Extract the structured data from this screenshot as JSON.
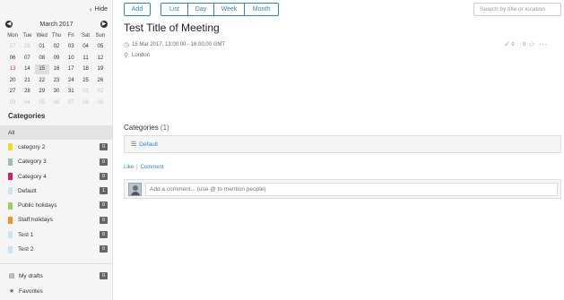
{
  "sidebar": {
    "hide_label": "Hide",
    "calendar": {
      "title": "March 2017",
      "weekdays": [
        "Mon",
        "Tue",
        "Wed",
        "Thu",
        "Fri",
        "Sat",
        "Sun"
      ],
      "weeks": [
        [
          {
            "d": "27",
            "s": "muted"
          },
          {
            "d": "28",
            "s": "muted"
          },
          {
            "d": "01",
            "s": ""
          },
          {
            "d": "02",
            "s": ""
          },
          {
            "d": "03",
            "s": ""
          },
          {
            "d": "04",
            "s": ""
          },
          {
            "d": "05",
            "s": ""
          }
        ],
        [
          {
            "d": "06",
            "s": ""
          },
          {
            "d": "07",
            "s": ""
          },
          {
            "d": "08",
            "s": ""
          },
          {
            "d": "09",
            "s": ""
          },
          {
            "d": "10",
            "s": ""
          },
          {
            "d": "11",
            "s": ""
          },
          {
            "d": "12",
            "s": ""
          }
        ],
        [
          {
            "d": "13",
            "s": "red"
          },
          {
            "d": "14",
            "s": ""
          },
          {
            "d": "15",
            "s": "today"
          },
          {
            "d": "16",
            "s": ""
          },
          {
            "d": "17",
            "s": ""
          },
          {
            "d": "18",
            "s": ""
          },
          {
            "d": "19",
            "s": ""
          }
        ],
        [
          {
            "d": "20",
            "s": ""
          },
          {
            "d": "21",
            "s": ""
          },
          {
            "d": "22",
            "s": ""
          },
          {
            "d": "23",
            "s": ""
          },
          {
            "d": "24",
            "s": ""
          },
          {
            "d": "25",
            "s": ""
          },
          {
            "d": "26",
            "s": ""
          }
        ],
        [
          {
            "d": "27",
            "s": ""
          },
          {
            "d": "28",
            "s": ""
          },
          {
            "d": "29",
            "s": ""
          },
          {
            "d": "30",
            "s": ""
          },
          {
            "d": "31",
            "s": ""
          },
          {
            "d": "01",
            "s": "muted"
          },
          {
            "d": "02",
            "s": "muted"
          }
        ],
        [
          {
            "d": "03",
            "s": "muted"
          },
          {
            "d": "04",
            "s": "muted"
          },
          {
            "d": "05",
            "s": "muted"
          },
          {
            "d": "06",
            "s": "muted"
          },
          {
            "d": "07",
            "s": "muted"
          },
          {
            "d": "08",
            "s": "muted"
          },
          {
            "d": "09",
            "s": "muted"
          }
        ]
      ]
    },
    "categories_title": "Categories",
    "categories": [
      {
        "label": "All",
        "color": "",
        "count": ""
      },
      {
        "label": "category 2",
        "color": "#f4d81b",
        "count": "0"
      },
      {
        "label": "Category 3",
        "color": "#8fc5b0",
        "count": "0"
      },
      {
        "label": "Category 4",
        "color": "#e2186b",
        "count": "0"
      },
      {
        "label": "Default",
        "color": "#c9e3f3",
        "count": "1"
      },
      {
        "label": "Public holidays",
        "color": "#9bd05b",
        "count": "0"
      },
      {
        "label": "Staff holidays",
        "color": "#f39222",
        "count": "0"
      },
      {
        "label": "Test 1",
        "color": "#c9e3f3",
        "count": "0"
      },
      {
        "label": "Test 2",
        "color": "#c9e3f3",
        "count": "0"
      }
    ],
    "drafts": {
      "label": "My drafts",
      "count": "0",
      "icon": "document-icon"
    },
    "favorites": {
      "label": "Favorites",
      "icon": "star-icon"
    }
  },
  "toolbar": {
    "add_label": "Add",
    "views": [
      "List",
      "Day",
      "Week",
      "Month"
    ],
    "search_placeholder": "Search by title or location"
  },
  "event": {
    "title": "Test Title of Meeting",
    "datetime": "15 Mar 2017, 13:00:00 - 16:00:00 GMT",
    "location": "London",
    "actions": {
      "approve_count": "0",
      "comment_count": "0"
    }
  },
  "categories_section": {
    "title": "Categories",
    "count": "(1)",
    "items": [
      "Default"
    ]
  },
  "social": {
    "like_label": "Like",
    "separator": "|",
    "comment_label": "Comment",
    "comment_placeholder": "Add a comment... (use @ to mention people)"
  },
  "colors": {
    "accent": "#2c86c6",
    "weekend_highlight": "#d9343f"
  }
}
